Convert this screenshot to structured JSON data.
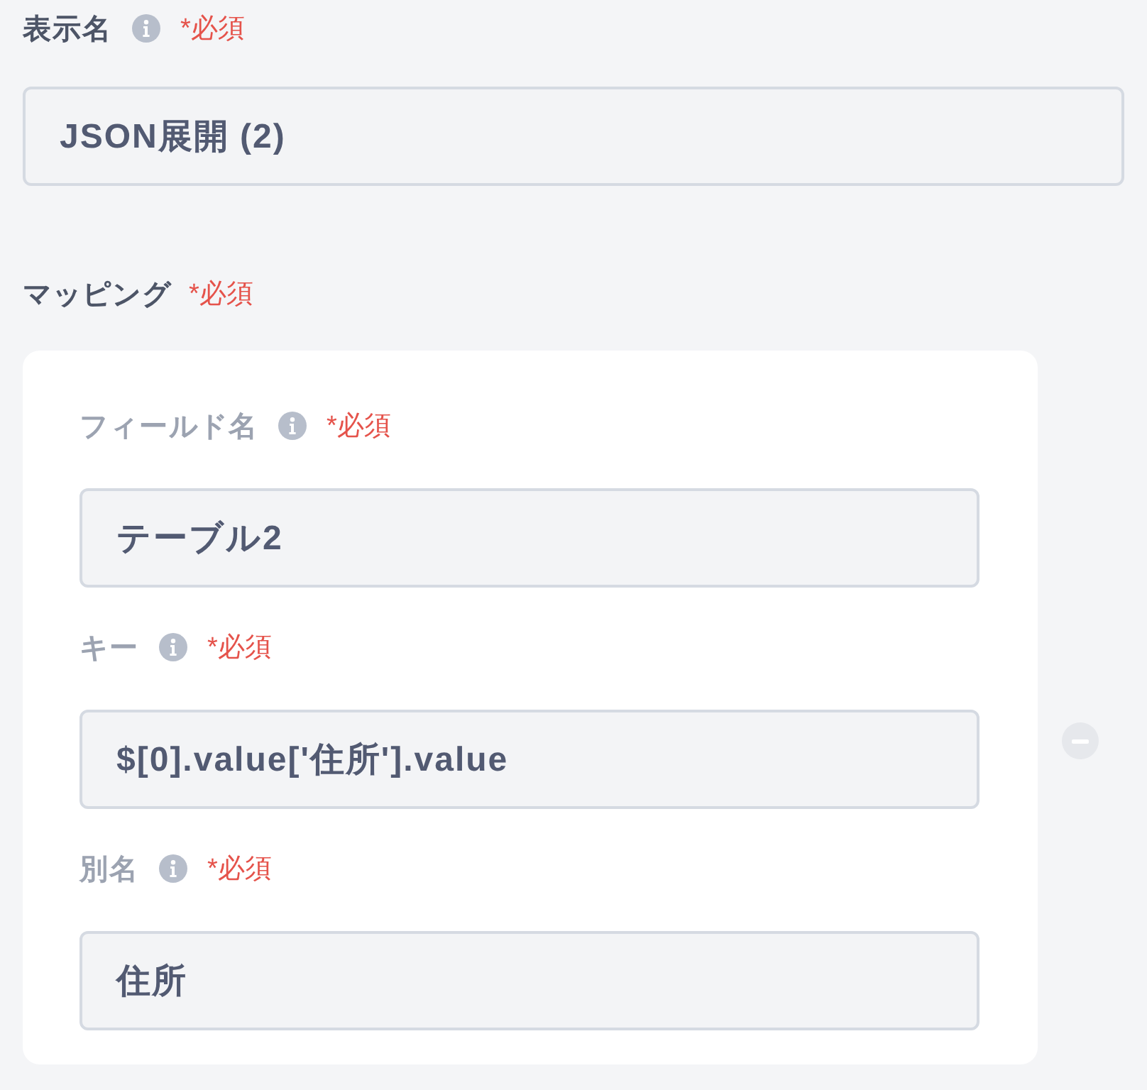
{
  "display_name": {
    "label": "表示名",
    "required": "*必須",
    "value": "JSON展開 (2)"
  },
  "mapping": {
    "label": "マッピング",
    "required": "*必須",
    "fields": [
      {
        "label": "フィールド名",
        "required": "*必須",
        "value": "テーブル2"
      },
      {
        "label": "キー",
        "required": "*必須",
        "value": "$[0].value['住所'].value"
      },
      {
        "label": "別名",
        "required": "*必須",
        "value": "住所"
      }
    ]
  }
}
